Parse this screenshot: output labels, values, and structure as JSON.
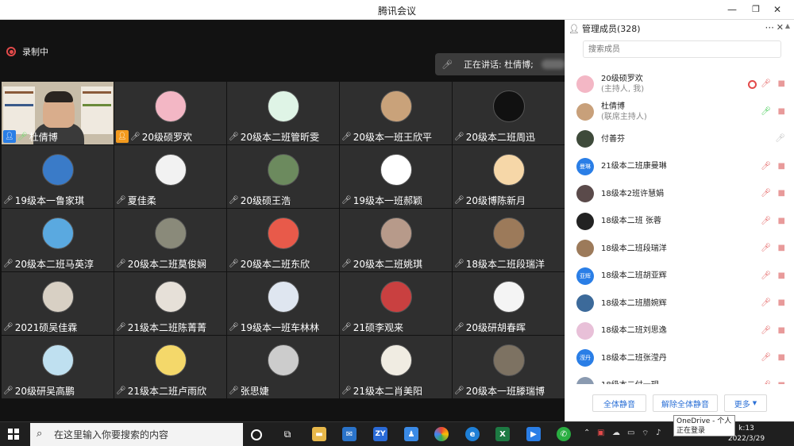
{
  "window": {
    "title": "腾讯会议"
  },
  "recording": {
    "label": "录制中"
  },
  "speaking": {
    "label": "正在讲话: 杜倩博;"
  },
  "grid": [
    {
      "name": "杜倩博",
      "badge": "cohost",
      "camera": true
    },
    {
      "name": "20级硕罗欢",
      "badge": "host",
      "avatar": "#f3b7c5"
    },
    {
      "name": "20级本二班管昕雯",
      "avatar": "#dff4e6"
    },
    {
      "name": "20级本一班王欣平",
      "avatar": "#c9a27a"
    },
    {
      "name": "20级本二班周迅",
      "avatar": "#111111"
    },
    {
      "name": "19级本一鲁家琪",
      "avatar": "#3a7bc8"
    },
    {
      "name": "夏佳柔",
      "avatar": "#f2f2f2"
    },
    {
      "name": "20级硕王浩",
      "avatar": "#6c8a5e"
    },
    {
      "name": "19级本一班郝颖",
      "avatar": "#ffffff"
    },
    {
      "name": "20级博陈新月",
      "avatar": "#f6d7a8"
    },
    {
      "name": "20级本二班马英淳",
      "avatar": "#5aa9e0"
    },
    {
      "name": "20级本二班莫俊娴",
      "avatar": "#8a8a7a"
    },
    {
      "name": "20级本二班东欣",
      "avatar": "#e85a4a"
    },
    {
      "name": "20级本二班姚琪",
      "avatar": "#b79a8a"
    },
    {
      "name": "18级本二班段瑞洋",
      "avatar": "#9c7a5a"
    },
    {
      "name": "2021硕吴佳霖",
      "avatar": "#d8d0c4"
    },
    {
      "name": "21级本二班陈菁菁",
      "avatar": "#e6e0d8"
    },
    {
      "name": "19级本一班车林林",
      "avatar": "#dfe6f0"
    },
    {
      "name": "21硕李观来",
      "avatar": "#c94040"
    },
    {
      "name": "20级研胡春晖",
      "avatar": "#f4f4f4"
    },
    {
      "name": "20级研吴高鹏",
      "avatar": "#bfe0f0"
    },
    {
      "name": "21级本二班卢雨欣",
      "avatar": "#f4d86a"
    },
    {
      "name": "张思婕",
      "avatar": "#cccccc"
    },
    {
      "name": "21级本二肖美阳",
      "avatar": "#f0ece2"
    },
    {
      "name": "20级本一班滕瑞博",
      "avatar": "#7d7262"
    }
  ],
  "panel": {
    "title": "管理成员(328)",
    "search_placeholder": "搜索成员",
    "members": [
      {
        "name": "20级硕罗欢",
        "role": "(主持人, 我)",
        "avatar": "#f3b7c5",
        "mic": "muted",
        "rec": true
      },
      {
        "name": "杜倩博",
        "role": "(联席主持人)",
        "avatar": "#c8a07a",
        "mic": "on"
      },
      {
        "name": "付善芬",
        "avatar": "#3e4a3a",
        "mic": "idle",
        "nocam": true
      },
      {
        "name": "21级本二班康曼琳",
        "avatar": "#2a7ee6",
        "avatar_text": "曼琳",
        "mic": "muted"
      },
      {
        "name": "18级本2班许慧娟",
        "avatar": "#5a4a4a",
        "mic": "muted"
      },
      {
        "name": "18级本二班 张蓉",
        "avatar": "#222222",
        "mic": "muted"
      },
      {
        "name": "18级本二班段瑞洋",
        "avatar": "#9c7a5a",
        "mic": "muted"
      },
      {
        "name": "18级本二班胡亚辉",
        "avatar": "#2a7ee6",
        "avatar_text": "亚辉",
        "mic": "muted"
      },
      {
        "name": "18级本二班腊婉辉",
        "avatar": "#3c6a9a",
        "mic": "muted"
      },
      {
        "name": "18级本二班刘思逸",
        "avatar": "#e8c0d8",
        "mic": "muted"
      },
      {
        "name": "18级本二班张滢丹",
        "avatar": "#2a7ee6",
        "avatar_text": "滢丹",
        "mic": "muted"
      },
      {
        "name": "18级本二付一玥",
        "avatar": "#8a9ab0",
        "mic": "muted"
      }
    ],
    "btn_mute_all": "全体静音",
    "btn_unmute_all": "解除全体静音",
    "btn_more": "更多"
  },
  "tooltip": {
    "line1": "OneDrive - 个人",
    "line2": "正在登录"
  },
  "taskbar": {
    "search_placeholder": "在这里输入你要搜索的内容",
    "clock_time": "k:13",
    "clock_date": "2022/3/29"
  }
}
